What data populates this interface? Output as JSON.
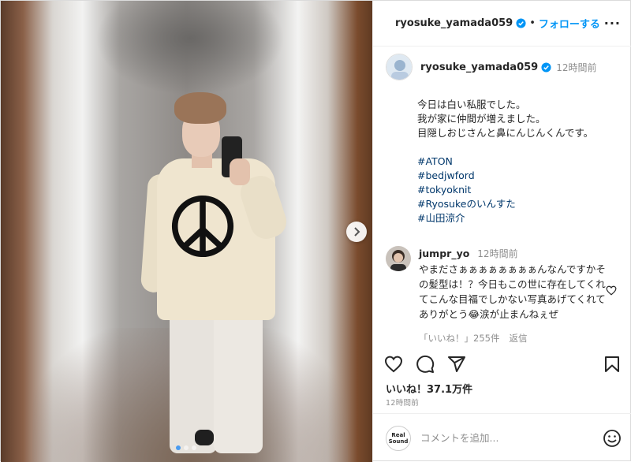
{
  "header": {
    "username": "ryosuke_yamada059",
    "separator": "•",
    "follow_label": "フォローする",
    "more_label": "···"
  },
  "caption": {
    "username": "ryosuke_yamada059",
    "time": "12時間前",
    "lines": [
      "今日は白い私服でした。",
      "我が家に仲間が増えました。",
      "目隠しおじさんと鼻にんじんくんです。"
    ],
    "hashtags": [
      "#ATON",
      "#bedjwford",
      "#tokyoknit",
      "#Ryosukeのいんすた",
      "#山田涼介"
    ]
  },
  "comment": {
    "username": "jumpr_yo",
    "time": "12時間前",
    "text": "やまださぁぁぁぁぁぁぁぁんなんですかその髪型は！？今日もこの世に存在してくれてこんな目福でしかない写真あげてくれてありがとう😂涙が止まんねぇぜ",
    "likes": "「いいね！」255件",
    "reply_label": "返信"
  },
  "post": {
    "likes": "いいね！37.1万件",
    "time": "12時間前",
    "carousel_dots": 3,
    "active_dot": 0
  },
  "add_comment": {
    "placeholder": "コメントを追加...",
    "avatar_text": "Real Sound"
  },
  "icons": {
    "verified": "verified-badge-icon",
    "next": "chevron-right-icon",
    "like": "heart-icon",
    "comment": "comment-bubble-icon",
    "share": "paper-plane-icon",
    "save": "bookmark-icon",
    "emoji": "emoji-smile-icon"
  },
  "colors": {
    "link_blue": "#0095f6",
    "hashtag": "#00376b",
    "muted": "#8e8e8e"
  }
}
